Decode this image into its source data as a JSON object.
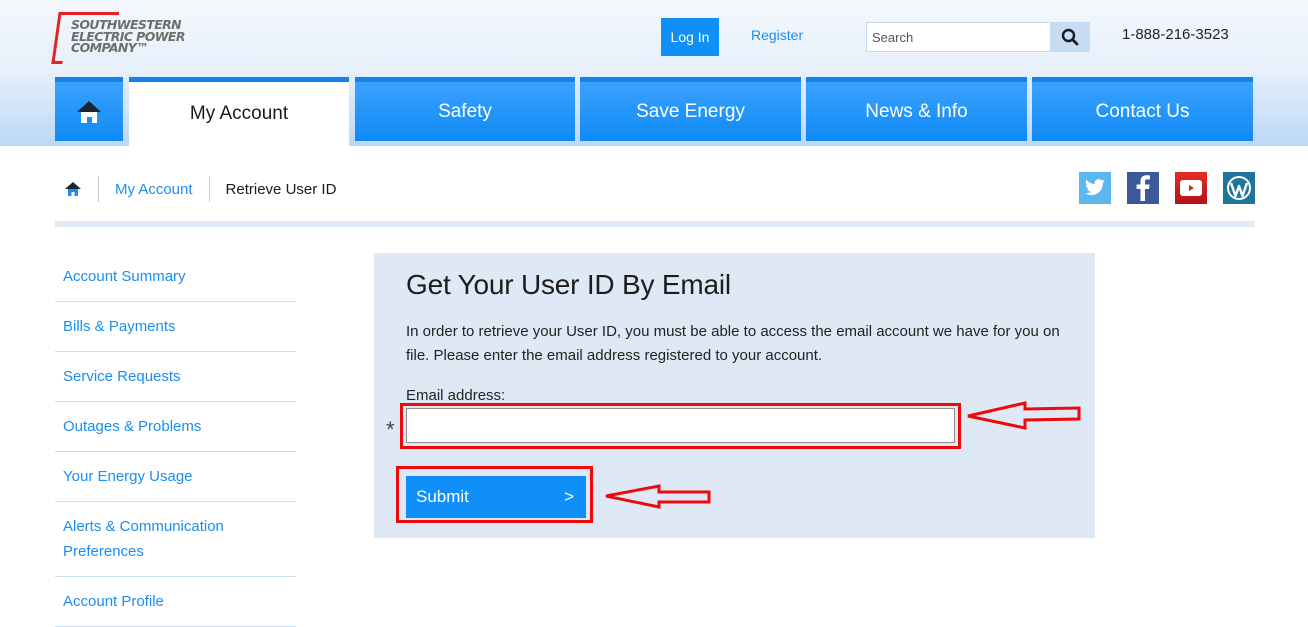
{
  "header": {
    "logo": {
      "line1": "SOUTHWESTERN",
      "line2": "ELECTRIC POWER",
      "line3": "COMPANY™"
    },
    "login_label": "Log In",
    "register_label": "Register",
    "search": {
      "placeholder": "Search",
      "value": "",
      "icon": "search-icon"
    },
    "phone": "1-888-216-3523"
  },
  "nav": {
    "home_icon": "home-icon",
    "items": [
      {
        "label": "My Account",
        "active": true
      },
      {
        "label": "Safety",
        "active": false
      },
      {
        "label": "Save Energy",
        "active": false
      },
      {
        "label": "News & Info",
        "active": false
      },
      {
        "label": "Contact Us",
        "active": false
      }
    ]
  },
  "breadcrumb": {
    "home_icon": "home-icon",
    "items": [
      {
        "label": "My Account",
        "link": true
      },
      {
        "label": "Retrieve User ID",
        "link": false
      }
    ]
  },
  "social": [
    "twitter-icon",
    "facebook-icon",
    "youtube-icon",
    "wordpress-icon"
  ],
  "sidebar": {
    "items": [
      {
        "label": "Account Summary"
      },
      {
        "label": "Bills & Payments"
      },
      {
        "label": "Service Requests"
      },
      {
        "label": "Outages & Problems"
      },
      {
        "label": "Your Energy Usage"
      },
      {
        "label": "Alerts & Communication Preferences"
      },
      {
        "label": "Account Profile"
      }
    ]
  },
  "form": {
    "title": "Get Your User ID By Email",
    "description": "In order to retrieve your User ID, you must be able to access the email account we have for you on file. Please enter the email address registered to your account.",
    "email_label": "Email address:",
    "required_mark": "*",
    "email_value": "",
    "submit_label": "Submit",
    "submit_chevron": ">"
  },
  "colors": {
    "accent_blue": "#0f8ff7",
    "link_blue": "#1a8ef2",
    "annotation_red": "#ee0a0a",
    "panel_bg": "#dfe9f5"
  }
}
